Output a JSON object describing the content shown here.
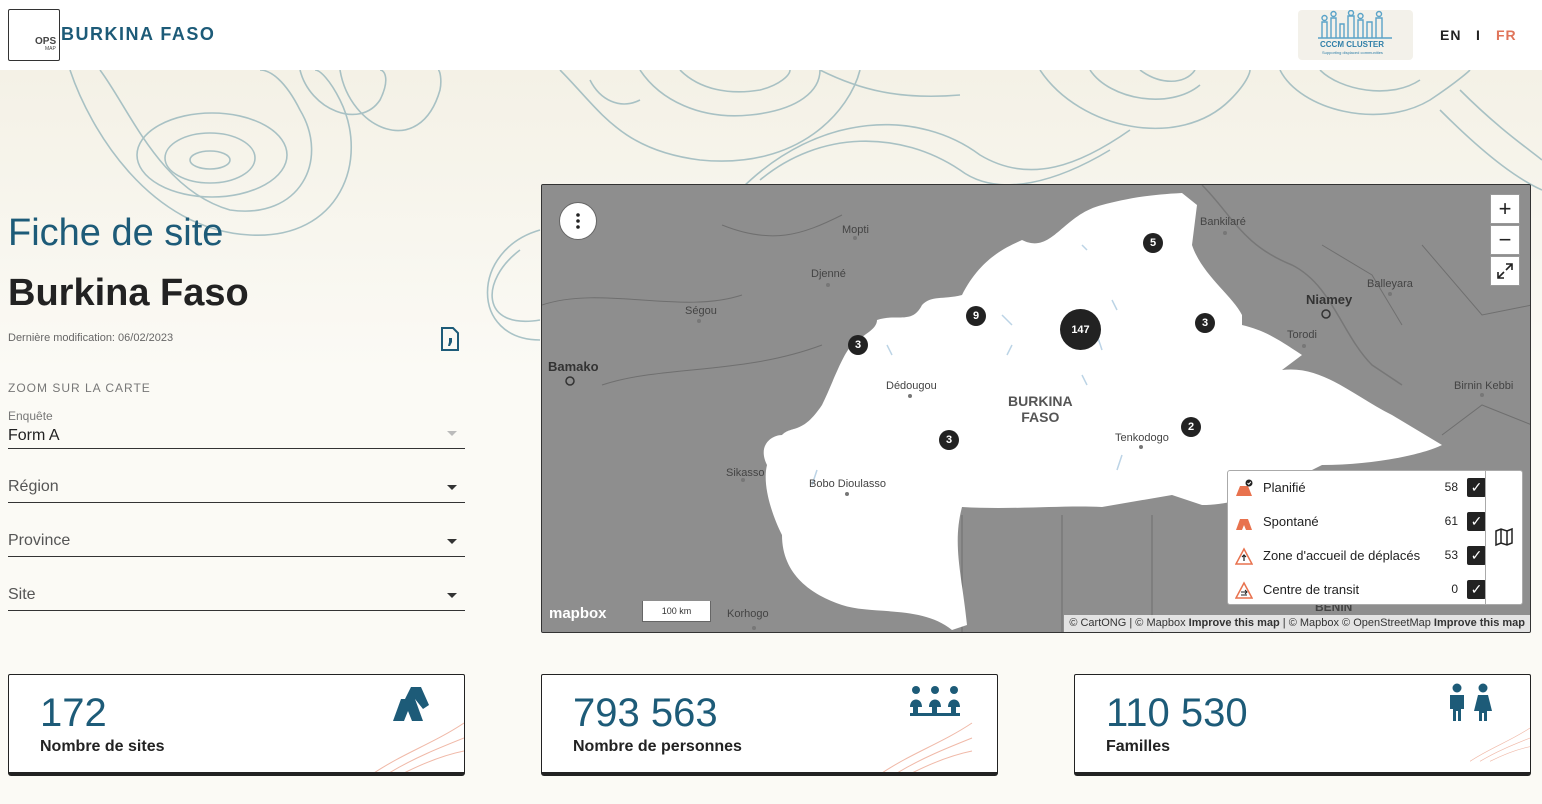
{
  "header": {
    "logo_ops": "OPS",
    "logo_map": "MAP",
    "brand": "BURKINA FASO",
    "partner_title": "CCCM CLUSTER",
    "partner_subtitle": "Supporting displaced communities",
    "lang_en": "EN",
    "lang_sep": "I",
    "lang_fr": "FR"
  },
  "sidebar": {
    "title": "Fiche de site",
    "country": "Burkina Faso",
    "last_modified": "Dernière modification: 06/02/2023",
    "zoom_heading": "ZOOM SUR LA CARTE",
    "fields": {
      "enquete_label": "Enquête",
      "enquete_value": "Form A",
      "region_placeholder": "Région",
      "province_placeholder": "Province",
      "site_placeholder": "Site"
    }
  },
  "map": {
    "cities": {
      "mopti": "Mopti",
      "djenne": "Djenné",
      "segou": "Ségou",
      "bamako": "Bamako",
      "sikasso": "Sikasso",
      "korhogo": "Korhogo",
      "dedougou": "Dédougou",
      "bobo": "Bobo Dioulasso",
      "tenkodogo": "Tenkodogo",
      "bankilare": "Bankilaré",
      "niamey": "Niamey",
      "balleyara": "Balleyara",
      "torodi": "Torodi",
      "birnin_kebbi": "Birnin Kebbi"
    },
    "country_label_line1": "BURKINA",
    "country_label_line2": "FASO",
    "benin_label": "BENIN",
    "clusters": {
      "c147": "147",
      "c9": "9",
      "c5": "5",
      "c3a": "3",
      "c3b": "3",
      "c3c": "3",
      "c2": "2"
    },
    "legend": [
      {
        "label": "Planifié",
        "count": "58"
      },
      {
        "label": "Spontané",
        "count": "61"
      },
      {
        "label": "Zone d'accueil de déplacés",
        "count": "53"
      },
      {
        "label": "Centre de transit",
        "count": "0"
      }
    ],
    "mapbox_logo": "mapbox",
    "scale": "100 km",
    "attribution_1": "© CartONG | © Mapbox ",
    "attribution_improve": "Improve this map",
    "attribution_2": " | © Mapbox © OpenStreetMap ",
    "attribution_improve2": "Improve this map",
    "zoom_in": "+",
    "zoom_out": "−"
  },
  "stats": [
    {
      "value": "172",
      "label": "Nombre de sites",
      "icon": "tent-icon"
    },
    {
      "value": "793 563",
      "label": "Nombre de personnes",
      "icon": "people-group-icon"
    },
    {
      "value": "110 530",
      "label": "Familles",
      "icon": "family-icon"
    }
  ],
  "colors": {
    "primary": "#1d5b78",
    "accent": "#e0745a",
    "legend_icon": "#e8724e"
  }
}
